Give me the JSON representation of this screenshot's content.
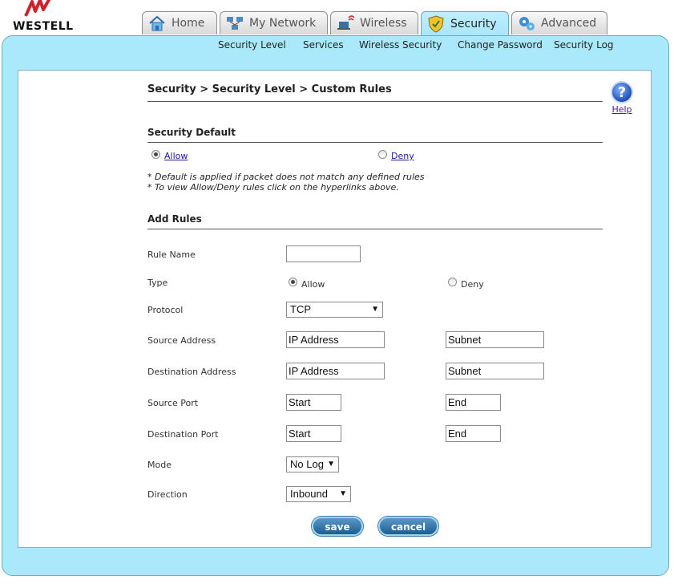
{
  "brand": {
    "name": "WESTELL"
  },
  "tabs": [
    {
      "label": "Home",
      "icon": "house-icon"
    },
    {
      "label": "My Network",
      "icon": "network-icon"
    },
    {
      "label": "Wireless",
      "icon": "wireless-laptop-icon"
    },
    {
      "label": "Security",
      "icon": "shield-icon",
      "active": true
    },
    {
      "label": "Advanced",
      "icon": "advanced-gears-icon"
    }
  ],
  "subnav": [
    "Security Level",
    "Services",
    "Wireless Security",
    "Change Password",
    "Security Log"
  ],
  "page_title": "Security > Security Level > Custom Rules",
  "help": {
    "symbol": "?",
    "label": "Help"
  },
  "security_default": {
    "heading": "Security Default",
    "allow": "Allow",
    "deny": "Deny",
    "selected": "Allow",
    "note1": "* Default is applied if packet does not match any defined rules",
    "note2": "* To view Allow/Deny rules click on the hyperlinks above."
  },
  "add_rules": {
    "heading": "Add Rules",
    "rule_name": {
      "label": "Rule Name",
      "value": ""
    },
    "type": {
      "label": "Type",
      "allow": "Allow",
      "deny": "Deny",
      "selected": "Allow"
    },
    "protocol": {
      "label": "Protocol",
      "value": "TCP"
    },
    "source_address": {
      "label": "Source Address",
      "ip": "IP Address",
      "subnet": "Subnet"
    },
    "destination_address": {
      "label": "Destination Address",
      "ip": "IP Address",
      "subnet": "Subnet"
    },
    "source_port": {
      "label": "Source Port",
      "start": "Start",
      "end": "End"
    },
    "destination_port": {
      "label": "Destination Port",
      "start": "Start",
      "end": "End"
    },
    "mode": {
      "label": "Mode",
      "value": "No Log"
    },
    "direction": {
      "label": "Direction",
      "value": "Inbound"
    }
  },
  "buttons": {
    "save": "save",
    "cancel": "cancel"
  },
  "colors": {
    "frame": "#a9e9fb",
    "button": "#1c5d93",
    "link": "#1a1aa6",
    "logo_red": "#d0202a"
  }
}
